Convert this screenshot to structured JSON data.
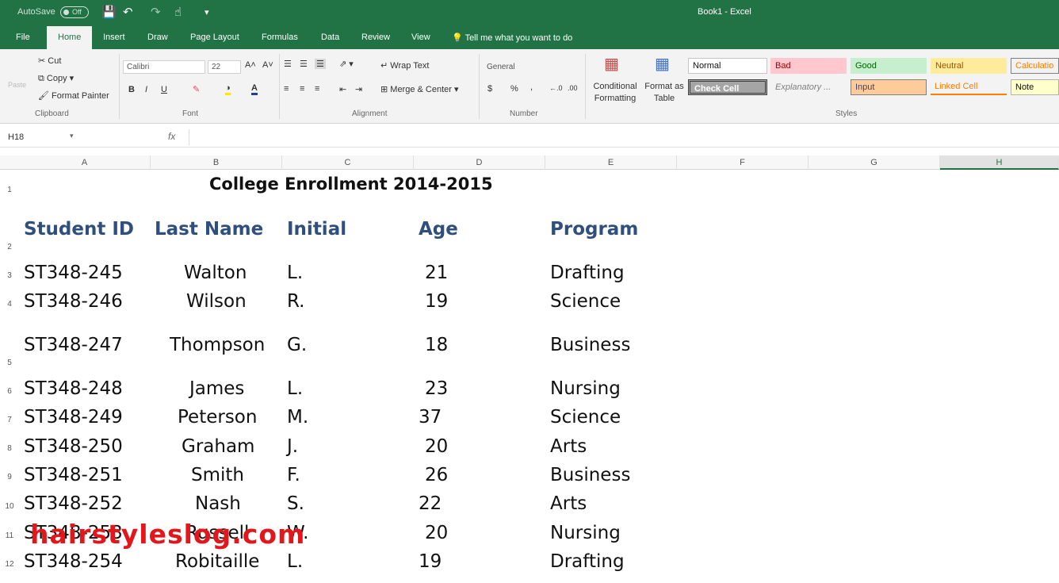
{
  "titlebar": {
    "autosave_label": "AutoSave",
    "autosave_state": "Off",
    "doc_title": "Book1  -  Excel"
  },
  "menu": {
    "tabs": [
      "File",
      "Home",
      "Insert",
      "Draw",
      "Page Layout",
      "Formulas",
      "Data",
      "Review",
      "View"
    ],
    "active": "Home",
    "tell_me": "Tell me what you want to do"
  },
  "ribbon": {
    "clipboard": {
      "paste": "Paste",
      "cut": "Cut",
      "copy": "Copy",
      "format_painter": "Format Painter",
      "group": "Clipboard"
    },
    "font": {
      "name": "Calibri",
      "size": "22",
      "bold": "B",
      "italic": "I",
      "underline": "U",
      "group": "Font"
    },
    "alignment": {
      "wrap_text": "Wrap Text",
      "merge_center": "Merge & Center",
      "group": "Alignment"
    },
    "number": {
      "format": "General",
      "currency": "$",
      "percent": "%",
      "comma": ",",
      "group": "Number"
    },
    "styles_group": {
      "conditional_formatting": "Conditional Formatting",
      "format_as_table": "Format as Table",
      "normal": "Normal",
      "bad": "Bad",
      "good": "Good",
      "neutral": "Neutral",
      "calculation": "Calculatio",
      "check_cell": "Check Cell",
      "explanatory": "Explanatory ...",
      "input": "Input",
      "linked_cell": "Linked Cell",
      "note": "Note",
      "group": "Styles"
    }
  },
  "formula_bar": {
    "name_box": "H18",
    "fx": "fx",
    "value": ""
  },
  "sheet": {
    "columns": [
      "A",
      "B",
      "C",
      "D",
      "E",
      "F",
      "G",
      "H"
    ],
    "selected_column": "H",
    "title": "College Enrollment 2014-2015",
    "headers": [
      "Student ID",
      "Last Name",
      "Initial",
      "Age",
      "Program"
    ],
    "rows": [
      [
        "ST348-245",
        "Walton",
        "L.",
        "21",
        "Drafting"
      ],
      [
        "ST348-246",
        "Wilson",
        "R.",
        "19",
        "Science"
      ],
      [
        "ST348-247",
        "Thompson",
        "G.",
        "18",
        "Business"
      ],
      [
        "ST348-248",
        "James",
        "L.",
        "23",
        "Nursing"
      ],
      [
        "ST348-249",
        "Peterson",
        "M.",
        "37",
        "Science"
      ],
      [
        "ST348-250",
        "Graham",
        "J.",
        "20",
        "Arts"
      ],
      [
        "ST348-251",
        "Smith",
        "F.",
        "26",
        "Business"
      ],
      [
        "ST348-252",
        "Nash",
        "S.",
        "22",
        "Arts"
      ],
      [
        "ST348-253",
        "Russell",
        "W.",
        "20",
        "Nursing"
      ],
      [
        "ST348-254",
        "Robitaille",
        "L.",
        "19",
        "Drafting"
      ]
    ],
    "row_numbers": [
      "1",
      "2",
      "3",
      "4",
      "5",
      "6",
      "7",
      "8",
      "9",
      "10",
      "11",
      "12"
    ]
  },
  "watermark": "hairstyleslog.com",
  "colors": {
    "excel_green": "#217346",
    "header_blue": "#2f4f7f",
    "watermark_red": "#e3171b"
  }
}
